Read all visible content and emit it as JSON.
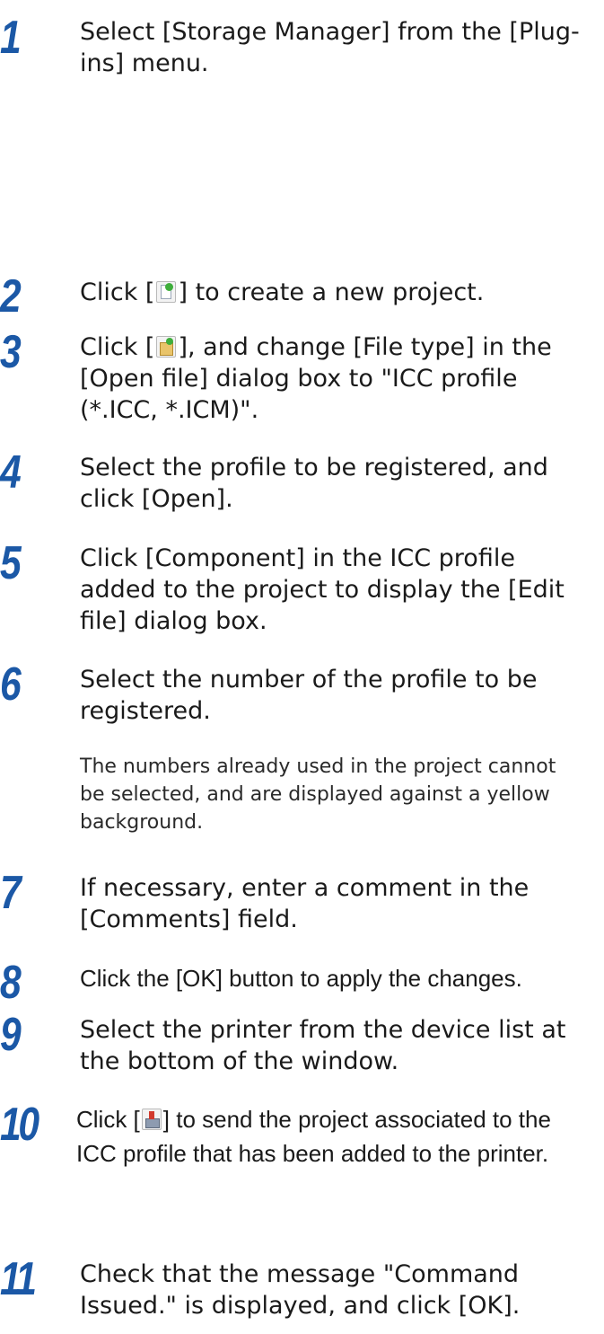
{
  "steps": [
    {
      "num": "1",
      "text_a": "Select [Storage Manager] from the [Plug-ins] menu."
    },
    {
      "num": "2",
      "text_a": "Click [",
      "icon": "new-project-icon",
      "text_b": "] to create a new project."
    },
    {
      "num": "3",
      "text_a": "Click [",
      "icon": "add-file-icon",
      "text_b": "], and change [File type] in the [Open file] dialog box to \"ICC profile (*.ICC, *.ICM)\"."
    },
    {
      "num": "4",
      "text_a": "Select the profile to be registered, and click [Open]."
    },
    {
      "num": "5",
      "text_a": "Click [Component] in the ICC profile added to the project to display the [Edit file] dialog box."
    },
    {
      "num": "6",
      "text_a": "Select the number of the profile to be registered.",
      "note": "The numbers already used in the project cannot be selected, and are displayed against a yellow background."
    },
    {
      "num": "7",
      "text_a": "If necessary, enter a comment in the [Comments] field."
    },
    {
      "num": "8",
      "text_a": "Click the [OK] button to apply the changes."
    },
    {
      "num": "9",
      "text_a": "Select the printer from the device list at the bottom of the window."
    },
    {
      "num": "10",
      "text_a": "Click [",
      "icon": "send-project-icon",
      "text_b": "] to send the project associated to the ICC profile that has been added to the printer."
    },
    {
      "num": "11",
      "text_a": "Check that the message \"Command Issued.\" is displayed, and click [OK]."
    }
  ]
}
